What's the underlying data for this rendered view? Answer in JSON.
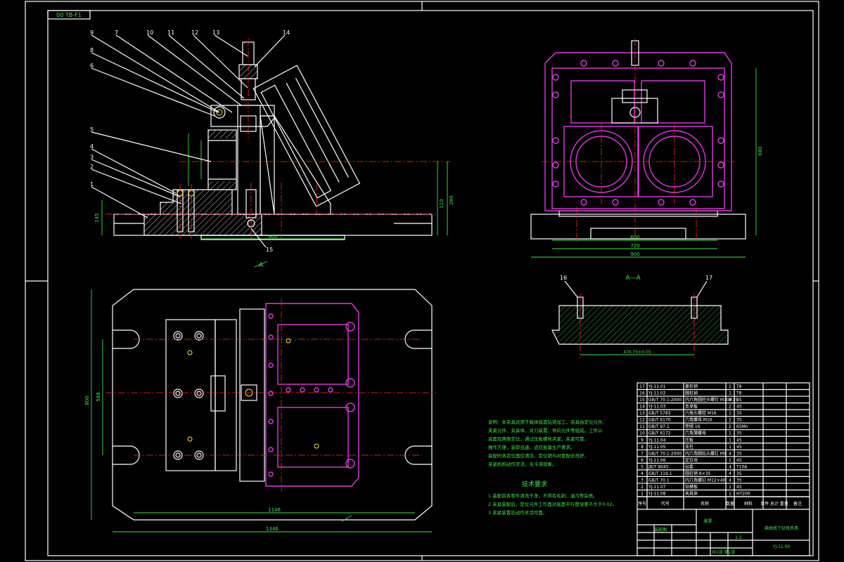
{
  "drawing": {
    "top_left_code": "00 TB-F1",
    "number": "YJ-11.00",
    "title": "箱体底下钻铣夹具",
    "section_label": "A—A",
    "view_arrow_label": "A",
    "tech_req_title": "技术要求"
  },
  "balloons": [
    "9",
    "8",
    "10",
    "11",
    "12",
    "13",
    "14",
    "7",
    "6",
    "5",
    "4",
    "3",
    "2",
    "1",
    "15",
    "16",
    "16",
    "17"
  ],
  "dimensions": {
    "front_width": "900",
    "front_height_a": "110",
    "front_height_b": "280",
    "front_h_small": "145",
    "side_inner": "600",
    "side_mid": "720",
    "side_total": "900",
    "side_height": "680",
    "plan_inner": "1146",
    "plan_total": "1346",
    "plan_height": "800",
    "plan_inner_h": "588",
    "section_len": "470.75±0.05"
  },
  "tech_text": [
    "说明：本夹具适用于箱体底面钻铣加工，夹具由定位元件、",
    "夹紧元件、夹具体、对刀装置、导向元件等组成。工件以",
    "底面及两侧定位，通过压板螺栓夹紧，夹紧可靠、",
    "操作方便，装卸迅速，适应批量生产要求。",
    "装配时各定位面应清洁，定位销与衬套配合良好，",
    "夹紧机构动作灵活，无卡滞现象。"
  ],
  "tech_req": [
    "1.装配前各零件清洗干净，不得有毛刺、油污等杂质。",
    "2.夹具装配后，定位元件工作面对底面平行度误差不大于0.02。",
    "3.夹紧装置应动作灵活可靠。"
  ],
  "parts_list": [
    {
      "no": "17",
      "code": "YJ-11.01",
      "name": "菱形销",
      "qty": "1",
      "mat": "T8",
      "note": ""
    },
    {
      "no": "16",
      "code": "YJ-11.02",
      "name": "圆柱销",
      "qty": "1",
      "mat": "T8",
      "note": ""
    },
    {
      "no": "15",
      "code": "GB/T 70.1-2000",
      "name": "内六角圆柱头螺钉 M10×35",
      "qty": "8",
      "mat": "35",
      "note": ""
    },
    {
      "no": "14",
      "code": "YJ-11.03",
      "name": "支承板",
      "qty": "2",
      "mat": "45",
      "note": ""
    },
    {
      "no": "13",
      "code": "GB/T 5783",
      "name": "六角头螺栓 M16",
      "qty": "1",
      "mat": "35",
      "note": ""
    },
    {
      "no": "12",
      "code": "GB/T 6170",
      "name": "六角螺母 M16",
      "qty": "2",
      "mat": "35",
      "note": ""
    },
    {
      "no": "11",
      "code": "GB/T 97.1",
      "name": "垫圈 16",
      "qty": "2",
      "mat": "65Mn",
      "note": ""
    },
    {
      "no": "10",
      "code": "GB/T 6172",
      "name": "六角薄螺母",
      "qty": "1",
      "mat": "35",
      "note": ""
    },
    {
      "no": "9",
      "code": "YJ-11.04",
      "name": "压板",
      "qty": "1",
      "mat": "45",
      "note": ""
    },
    {
      "no": "8",
      "code": "YJ-11.05",
      "name": "支柱",
      "qty": "1",
      "mat": "45",
      "note": ""
    },
    {
      "no": "7",
      "code": "GB/T 70.1-2000",
      "name": "内六角圆柱头螺钉 M8",
      "qty": "4",
      "mat": "35",
      "note": ""
    },
    {
      "no": "6",
      "code": "YJ-11.06",
      "name": "定位块",
      "qty": "1",
      "mat": "45",
      "note": ""
    },
    {
      "no": "5",
      "code": "JB/T 8045",
      "name": "钻套",
      "qty": "4",
      "mat": "T10A",
      "note": ""
    },
    {
      "no": "4",
      "code": "GB/T 119.1",
      "name": "圆柱销 8×35",
      "qty": "4",
      "mat": "35",
      "note": ""
    },
    {
      "no": "3",
      "code": "GB/T 70.1",
      "name": "内六角螺钉 M12×40",
      "qty": "4",
      "mat": "35",
      "note": ""
    },
    {
      "no": "2",
      "code": "YJ-11.07",
      "name": "钻模板",
      "qty": "1",
      "mat": "45",
      "note": ""
    },
    {
      "no": "1",
      "code": "YJ-11.08",
      "name": "夹具体",
      "qty": "1",
      "mat": "HT200",
      "note": ""
    }
  ],
  "parts_header": {
    "no": "序号",
    "code": "代号",
    "name": "名称",
    "qty": "数量",
    "mat": "材料",
    "weight": "单件 总计 重量",
    "note": "备注"
  },
  "title_block": {
    "company": "湘潭",
    "assembly_label": "装配图",
    "scale": "1:2",
    "sheet": "共1张 第1张"
  }
}
